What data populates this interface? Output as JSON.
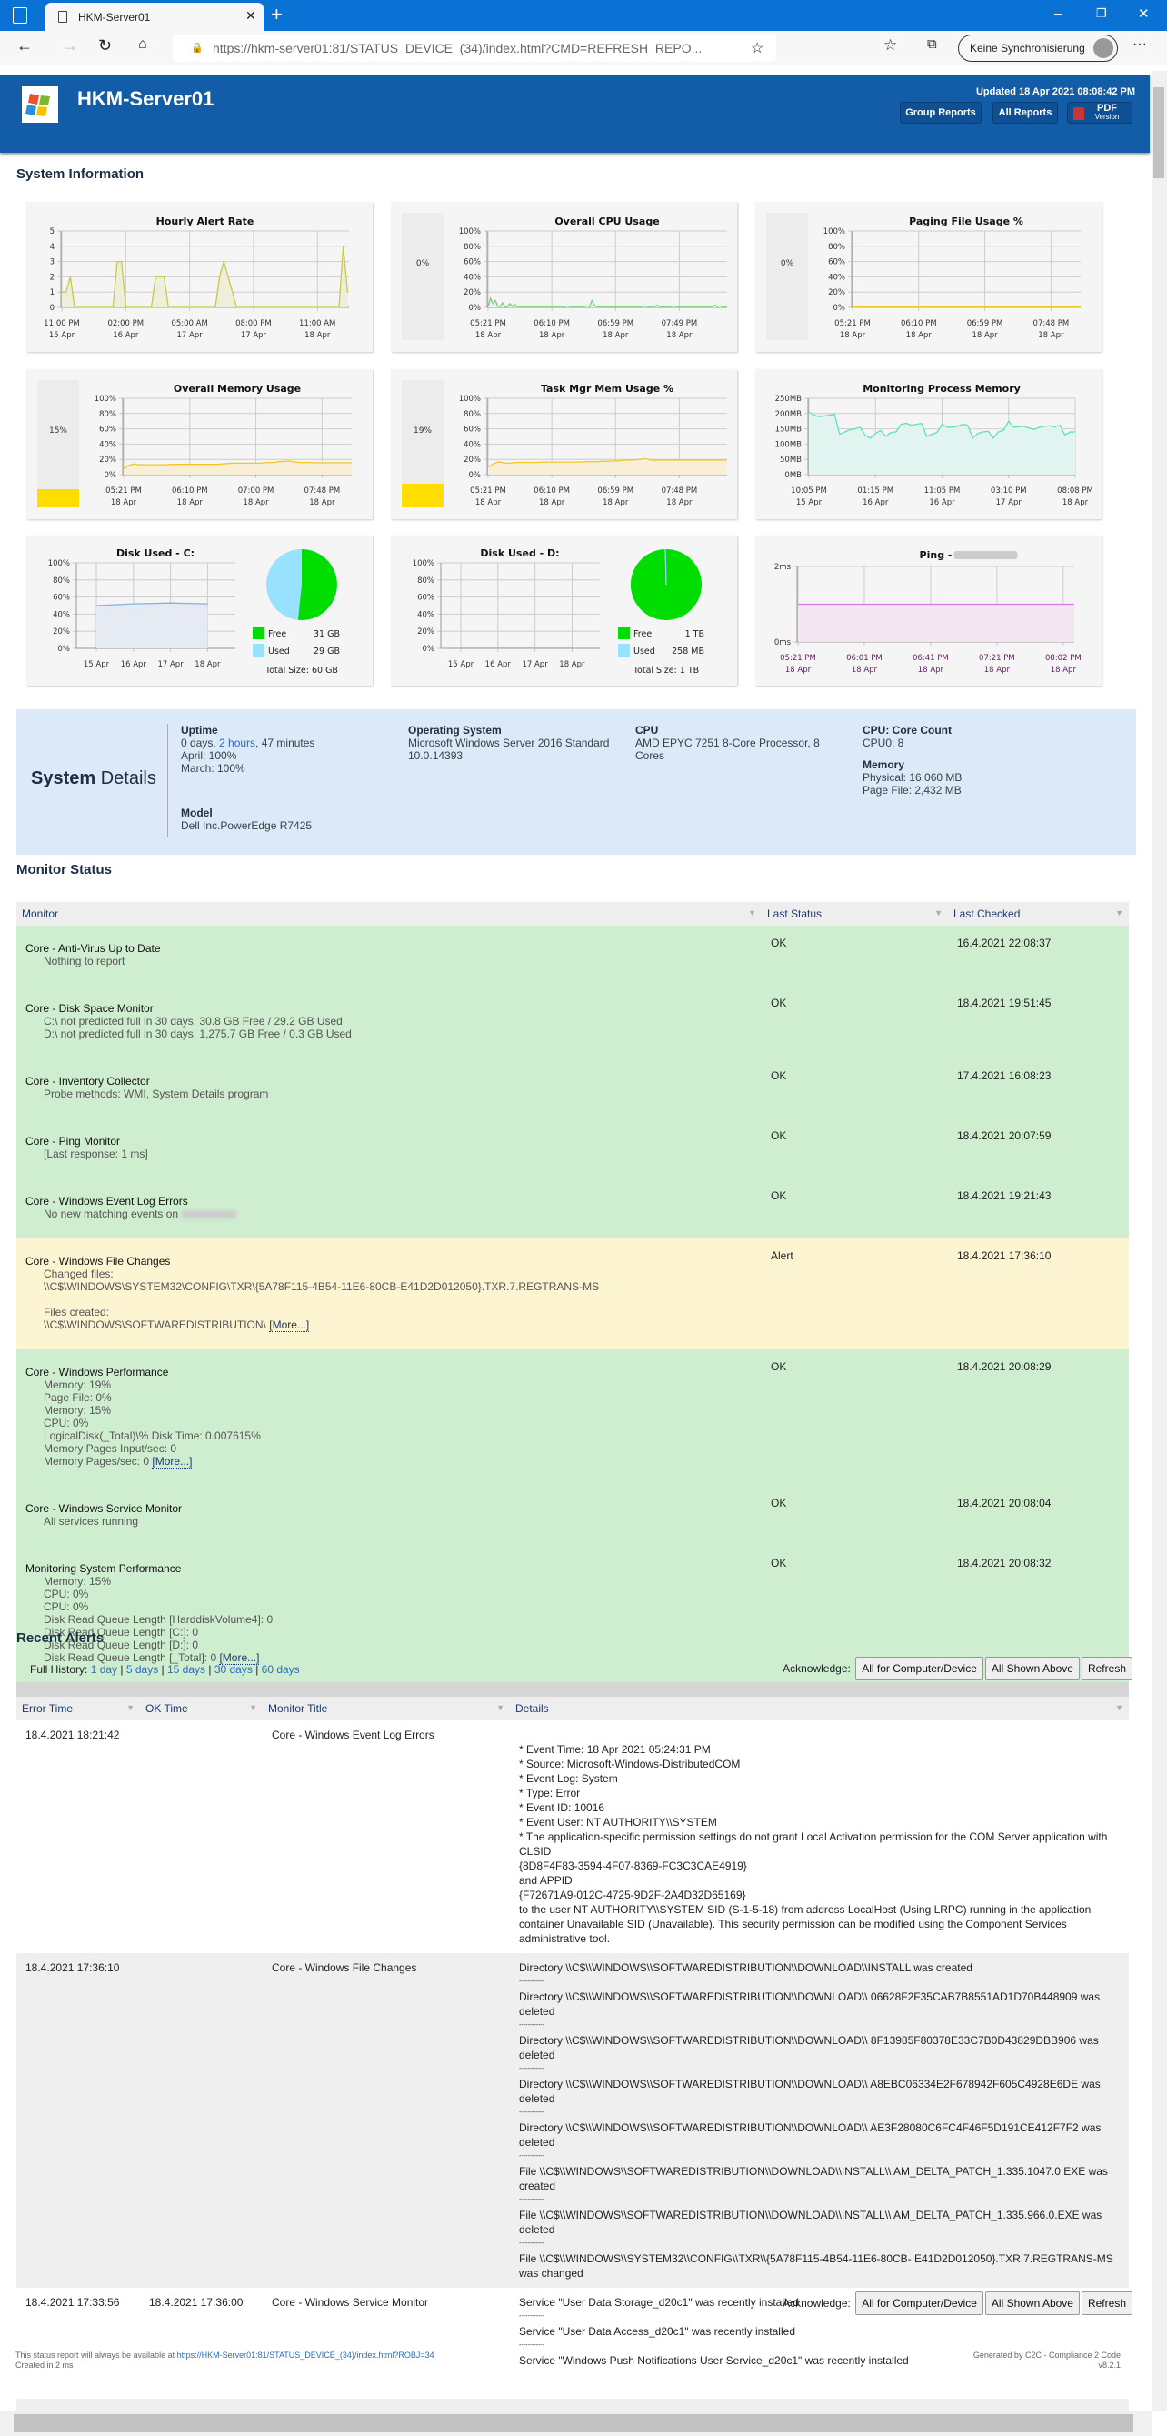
{
  "browser": {
    "tab_title": "HKM-Server01",
    "url": "https://hkm-server01:81/STATUS_DEVICE_(34)/index.html?CMD=REFRESH_REPO...",
    "url_host": "hkm-server01",
    "profile_label": "Keine Synchronisierung"
  },
  "header": {
    "title": "HKM-Server01",
    "updated": "Updated 18 Apr 2021 08:08:42 PM",
    "group_reports": "Group Reports",
    "all_reports": "All Reports",
    "pdf_label": "PDF",
    "pdf_sub": "Version"
  },
  "system_information": {
    "heading": "System Information"
  },
  "chart_data": [
    {
      "id": "hourly",
      "type": "area",
      "title": "Hourly Alert Rate",
      "yticks": [
        "0",
        "1",
        "2",
        "3",
        "4",
        "5"
      ],
      "ylim": [
        0,
        5
      ],
      "xticks": [
        [
          "11:00 PM",
          "15 Apr"
        ],
        [
          "02:00 PM",
          "16 Apr"
        ],
        [
          "05:00 AM",
          "17 Apr"
        ],
        [
          "08:00 PM",
          "17 Apr"
        ],
        [
          "11:00 AM",
          "18 Apr"
        ]
      ],
      "color": "#c5ca4c",
      "fill": "#eeeedb",
      "values": [
        1,
        1,
        2,
        0,
        0,
        0,
        0,
        0,
        0,
        0,
        0,
        0,
        0,
        3,
        3,
        0,
        0,
        0,
        0,
        0,
        0,
        0,
        2,
        2,
        2,
        0,
        0,
        0,
        0,
        0,
        0,
        0,
        0,
        0,
        0,
        0,
        0,
        2,
        3,
        2,
        1,
        0,
        0,
        0,
        0,
        0,
        0,
        0,
        0,
        0,
        0,
        0,
        0,
        0,
        0,
        0,
        0,
        0,
        0,
        0,
        0,
        0,
        0,
        0,
        0,
        0,
        4,
        1
      ]
    },
    {
      "id": "cpu",
      "type": "area",
      "title": "Overall CPU Usage",
      "gauge": 0,
      "gauge_label": "0%",
      "yticks": [
        "0%",
        "20%",
        "40%",
        "60%",
        "80%",
        "100%"
      ],
      "ylim": [
        0,
        100
      ],
      "xticks": [
        [
          "05:21 PM",
          "18 Apr"
        ],
        [
          "06:10 PM",
          "18 Apr"
        ],
        [
          "06:59 PM",
          "18 Apr"
        ],
        [
          "07:49 PM",
          "18 Apr"
        ]
      ],
      "color": "#79d079",
      "fill": "#e8f4e8",
      "values": [
        1,
        12,
        5,
        9,
        2,
        1,
        6,
        1,
        1,
        5,
        1,
        4,
        1,
        1,
        1,
        0,
        1,
        1,
        1,
        1,
        1,
        1,
        1,
        1,
        1,
        1,
        1,
        1,
        1,
        1,
        1,
        1,
        1,
        2,
        1,
        1,
        1,
        1,
        1,
        1,
        1,
        2,
        1,
        9,
        3,
        1,
        1,
        1,
        1,
        1,
        1,
        1,
        1,
        1,
        1,
        1,
        1,
        1,
        1,
        1,
        1,
        1,
        1,
        1,
        1,
        2,
        1,
        1,
        1,
        1,
        3,
        1,
        1,
        1,
        1,
        1,
        1,
        2,
        1,
        1,
        1,
        1,
        1,
        1,
        1,
        1,
        1,
        1,
        1,
        1,
        1,
        1,
        1,
        1,
        3,
        1,
        2,
        1,
        1,
        1
      ]
    },
    {
      "id": "paging",
      "type": "area",
      "title": "Paging File Usage %",
      "gauge": 0,
      "gauge_label": "0%",
      "yticks": [
        "0%",
        "20%",
        "40%",
        "60%",
        "80%",
        "100%"
      ],
      "ylim": [
        0,
        100
      ],
      "xticks": [
        [
          "05:21 PM",
          "18 Apr"
        ],
        [
          "06:10 PM",
          "18 Apr"
        ],
        [
          "06:59 PM",
          "18 Apr"
        ],
        [
          "07:48 PM",
          "18 Apr"
        ]
      ],
      "color": "#f3c624",
      "fill": "#f7efd0",
      "values": [
        0.5,
        0.5,
        0.5,
        0.5,
        0.5,
        0.5,
        0.5,
        0.5,
        0.5,
        0.5
      ]
    },
    {
      "id": "memory",
      "type": "area",
      "title": "Overall Memory Usage",
      "gauge": 15,
      "gauge_label": "15%",
      "yticks": [
        "0%",
        "20%",
        "40%",
        "60%",
        "80%",
        "100%"
      ],
      "ylim": [
        0,
        100
      ],
      "xticks": [
        [
          "05:21 PM",
          "18 Apr"
        ],
        [
          "06:10 PM",
          "18 Apr"
        ],
        [
          "07:00 PM",
          "18 Apr"
        ],
        [
          "07:48 PM",
          "18 Apr"
        ]
      ],
      "color": "#f3c624",
      "fill": "#f8efd6",
      "values": [
        8,
        12,
        14,
        13,
        13,
        13,
        13,
        13,
        13,
        13.5,
        13.5,
        13.5,
        13.5,
        13.5,
        13.5,
        13.5,
        13.5,
        13.5,
        13.5,
        14,
        14.5,
        15,
        15,
        15,
        15,
        15,
        15,
        15.5,
        16,
        16,
        17,
        17.5,
        18,
        16.5,
        16,
        16,
        16,
        15.5,
        15.5,
        15.5,
        15.5,
        15.5,
        15.5,
        15.5,
        15.5
      ]
    },
    {
      "id": "taskmgr",
      "type": "area",
      "title": "Task Mgr Mem Usage %",
      "gauge": 19,
      "gauge_label": "19%",
      "yticks": [
        "0%",
        "20%",
        "40%",
        "60%",
        "80%",
        "100%"
      ],
      "ylim": [
        0,
        100
      ],
      "xticks": [
        [
          "05:21 PM",
          "18 Apr"
        ],
        [
          "06:10 PM",
          "18 Apr"
        ],
        [
          "06:59 PM",
          "18 Apr"
        ],
        [
          "07:48 PM",
          "18 Apr"
        ]
      ],
      "color": "#f3c624",
      "fill": "#f8efd6",
      "values": [
        10,
        14,
        17,
        15,
        15,
        16,
        16,
        16,
        16,
        16,
        16.5,
        16.5,
        16.5,
        16.5,
        16.5,
        16.5,
        16.5,
        16.5,
        17,
        17,
        17,
        17.5,
        17.5,
        18,
        18,
        19,
        19,
        19.5,
        20,
        21,
        19,
        19,
        19,
        19,
        19,
        19,
        19,
        19,
        19,
        19,
        19,
        19,
        19,
        19,
        19
      ]
    },
    {
      "id": "procmem",
      "type": "area",
      "title": "Monitoring Process Memory",
      "yticks": [
        "0MB",
        "50MB",
        "100MB",
        "150MB",
        "200MB",
        "250MB"
      ],
      "ylim": [
        0,
        250
      ],
      "xticks": [
        [
          "10:05 PM",
          "15 Apr"
        ],
        [
          "01:15 PM",
          "16 Apr"
        ],
        [
          "11:05 PM",
          "16 Apr"
        ],
        [
          "03:10 PM",
          "17 Apr"
        ],
        [
          "08:08 PM",
          "18 Apr"
        ]
      ],
      "color": "#5fe0c2",
      "fill": "#e1f4ef",
      "values": [
        205,
        195,
        190,
        192,
        195,
        197,
        132,
        140,
        147,
        150,
        155,
        128,
        120,
        135,
        145,
        125,
        138,
        140,
        165,
        168,
        162,
        165,
        168,
        125,
        132,
        138,
        165,
        155,
        155,
        158,
        165,
        162,
        120,
        135,
        140,
        142,
        120,
        140,
        145,
        175,
        155,
        157,
        158,
        152,
        148,
        155,
        158,
        160,
        156,
        162,
        130,
        140,
        140
      ]
    },
    {
      "id": "diskc",
      "type": "disk",
      "title": "Disk Used - C:",
      "yticks": [
        "0%",
        "20%",
        "40%",
        "60%",
        "80%",
        "100%"
      ],
      "ylim": [
        0,
        100
      ],
      "xticks": [
        [
          "15 Apr",
          ""
        ],
        [
          "16 Apr",
          ""
        ],
        [
          "17 Apr",
          ""
        ],
        [
          "18 Apr",
          ""
        ]
      ],
      "color": "#86b2e6",
      "fill": "#e6eaf3",
      "values": [
        50,
        52,
        53,
        52
      ],
      "pie": {
        "free": 31,
        "used": 29,
        "free_label": "Free",
        "used_label": "Used",
        "free_value": "31 GB",
        "used_value": "29 GB",
        "total": "Total Size: 60 GB"
      }
    },
    {
      "id": "diskd",
      "type": "disk",
      "title": "Disk Used - D:",
      "yticks": [
        "0%",
        "20%",
        "40%",
        "60%",
        "80%",
        "100%"
      ],
      "ylim": [
        0,
        100
      ],
      "xticks": [
        [
          "15 Apr",
          ""
        ],
        [
          "16 Apr",
          ""
        ],
        [
          "17 Apr",
          ""
        ],
        [
          "18 Apr",
          ""
        ]
      ],
      "color": "#86b2e6",
      "fill": "#e6eaf3",
      "values": [
        1,
        1,
        1,
        1
      ],
      "pie": {
        "free": 1024,
        "used": 0.258,
        "free_label": "Free",
        "used_label": "Used",
        "free_value": "1 TB",
        "used_value": "258 MB",
        "total": "Total Size: 1 TB"
      }
    },
    {
      "id": "ping",
      "type": "area",
      "title": "Ping -",
      "yticks": [
        "0ms",
        "2ms"
      ],
      "ylim": [
        0,
        2
      ],
      "xticks": [
        [
          "05:21 PM",
          "18 Apr"
        ],
        [
          "06:01 PM",
          "18 Apr"
        ],
        [
          "06:41 PM",
          "18 Apr"
        ],
        [
          "07:21 PM",
          "18 Apr"
        ],
        [
          "08:02 PM",
          "18 Apr"
        ]
      ],
      "color": "#d47ae4",
      "fill": "#f2e6f3",
      "values": [
        1,
        1,
        1,
        1,
        1
      ]
    }
  ],
  "colors": {
    "pie_free": "#00dd00",
    "pie_used": "#99e2ff",
    "gauge_fill": "#ffdd00",
    "ok_row": "#cfedcf",
    "alert_row": "#fdf4d2",
    "header": "#125ca8"
  },
  "system_details": {
    "title_bold": "System",
    "title_rest": " Details",
    "uptime": {
      "label": "Uptime",
      "line1_a": "0 days, ",
      "line1_b": "2 hours",
      "line1_c": ", 47 minutes",
      "april": "April: 100%",
      "march": "March: 100%"
    },
    "os": {
      "label": "Operating System",
      "line1": "Microsoft Windows Server 2016 Standard",
      "line2": "10.0.14393"
    },
    "cpu": {
      "label": "CPU",
      "line1": "AMD EPYC 7251 8-Core Processor, 8",
      "line2": "Cores"
    },
    "cores": {
      "label": "CPU: Core Count",
      "value": "CPU0: 8"
    },
    "memory": {
      "label": "Memory",
      "physical": "Physical: 16,060 MB",
      "pagefile": "Page File: 2,432 MB"
    },
    "model": {
      "label": "Model",
      "value": "Dell Inc.PowerEdge R7425"
    }
  },
  "monitor_status": {
    "heading": "Monitor Status",
    "columns": [
      "Monitor",
      "Last Status",
      "Last Checked"
    ],
    "rows": [
      {
        "title": "Core - Anti-Virus Up to Date",
        "lines": [
          "Nothing to report"
        ],
        "status": "OK",
        "checked": "16.4.2021 22:08:37",
        "state": "ok"
      },
      {
        "title": "Core - Disk Space Monitor",
        "lines": [
          "C:\\ not predicted full in 30 days, 30.8 GB Free / 29.2 GB Used",
          "D:\\ not predicted full in 30 days, 1,275.7 GB Free / 0.3 GB Used"
        ],
        "status": "OK",
        "checked": "18.4.2021 19:51:45",
        "state": "ok"
      },
      {
        "title": "Core - Inventory Collector",
        "lines": [
          "Probe methods: WMI, System Details program"
        ],
        "status": "OK",
        "checked": "17.4.2021 16:08:23",
        "state": "ok"
      },
      {
        "title": "Core - Ping Monitor",
        "lines": [
          "[Last response: 1 ms]"
        ],
        "status": "OK",
        "checked": "18.4.2021 20:07:59",
        "state": "ok"
      },
      {
        "title": "Core - Windows Event Log Errors",
        "lines": [
          "No new matching events on"
        ],
        "blur_last": true,
        "status": "OK",
        "checked": "18.4.2021 19:21:43",
        "state": "ok"
      },
      {
        "title": "Core - Windows File Changes",
        "lines": [
          "Changed files:",
          "\\\\C$\\WINDOWS\\SYSTEM32\\CONFIG\\TXR\\{5A78F115-4B54-11E6-80CB-E41D2D012050}.TXR.7.REGTRANS-MS",
          "",
          "Files created:",
          "\\\\C$\\WINDOWS\\SOFTWAREDISTRIBUTION\\"
        ],
        "more": "[More...]",
        "status": "Alert",
        "checked": "18.4.2021 17:36:10",
        "state": "alert"
      },
      {
        "title": "Core - Windows Performance",
        "lines": [
          "Memory: 19%",
          "Page File: 0%",
          "Memory: 15%",
          "CPU: 0%",
          "LogicalDisk(_Total)\\% Disk Time: 0.007615%",
          "Memory Pages Input/sec: 0",
          "Memory Pages/sec: 0"
        ],
        "more": "[More...]",
        "status": "OK",
        "checked": "18.4.2021 20:08:29",
        "state": "ok"
      },
      {
        "title": "Core - Windows Service Monitor",
        "lines": [
          "All services running"
        ],
        "status": "OK",
        "checked": "18.4.2021 20:08:04",
        "state": "ok"
      },
      {
        "title": "Monitoring System Performance",
        "lines": [
          "Memory: 15%",
          "CPU: 0%",
          "CPU: 0%",
          "Disk Read Queue Length [HarddiskVolume4]: 0",
          "Disk Read Queue Length [C:]: 0",
          "Disk Read Queue Length [D:]: 0",
          "Disk Read Queue Length [_Total]: 0"
        ],
        "more": "[More...]",
        "status": "OK",
        "checked": "18.4.2021 20:08:32",
        "state": "ok"
      }
    ]
  },
  "recent_alerts": {
    "heading": "Recent Alerts",
    "history_label": "Full History:",
    "history_links": [
      "1 day",
      "5 days",
      "15 days",
      "30 days",
      "60 days"
    ],
    "acknowledge_label": "Acknowledge:",
    "btn_all_device": "All for Computer/Device",
    "btn_all_shown": "All Shown Above",
    "btn_refresh": "Refresh",
    "columns": [
      "Error Time",
      "OK Time",
      "Monitor Title",
      "Details"
    ],
    "rows": [
      {
        "error_time": "18.4.2021 18:21:42",
        "ok_time": "",
        "title": "Core - Windows Event Log Errors",
        "details": [
          "",
          "* Event Time: 18 Apr 2021 05:24:31 PM",
          "* Source: Microsoft-Windows-DistributedCOM",
          "* Event Log: System",
          "* Type: Error",
          "* Event ID: 10016",
          "* Event User: NT AUTHORITY\\\\SYSTEM",
          "* The application-specific permission settings do not grant Local Activation permission for the COM Server application with CLSID",
          "{8D8F4F83-3594-4F07-8369-FC3C3CAE4919}",
          "and APPID",
          "{F72671A9-012C-4725-9D2F-2A4D32D65169}",
          "to the user NT AUTHORITY\\\\SYSTEM SID (S-1-5-18) from address LocalHost (Using LRPC) running in the application container Unavailable SID (Unavailable). This security permission can be modified using the Component Services administrative tool."
        ]
      },
      {
        "error_time": "18.4.2021 17:36:10",
        "ok_time": "",
        "title": "Core - Windows File Changes",
        "details": [
          "Directory \\\\C$\\\\WINDOWS\\\\SOFTWAREDISTRIBUTION\\\\DOWNLOAD\\\\INSTALL was created",
          "------------",
          "Directory \\\\C$\\\\WINDOWS\\\\SOFTWAREDISTRIBUTION\\\\DOWNLOAD\\\\ 06628F2F35CAB7B8551AD1D70B448909 was deleted",
          "------------",
          "Directory \\\\C$\\\\WINDOWS\\\\SOFTWAREDISTRIBUTION\\\\DOWNLOAD\\\\ 8F13985F80378E33C7B0D43829DBB906 was deleted",
          "------------",
          "Directory \\\\C$\\\\WINDOWS\\\\SOFTWAREDISTRIBUTION\\\\DOWNLOAD\\\\ A8EBC06334E2F678942F605C4928E6DE was deleted",
          "------------",
          "Directory \\\\C$\\\\WINDOWS\\\\SOFTWAREDISTRIBUTION\\\\DOWNLOAD\\\\ AE3F28080C6FC4F46F5D191CE412F7F2 was deleted",
          "------------",
          "File \\\\C$\\\\WINDOWS\\\\SOFTWAREDISTRIBUTION\\\\DOWNLOAD\\\\INSTALL\\\\ AM_DELTA_PATCH_1.335.1047.0.EXE was created",
          "------------",
          "File \\\\C$\\\\WINDOWS\\\\SOFTWAREDISTRIBUTION\\\\DOWNLOAD\\\\INSTALL\\\\ AM_DELTA_PATCH_1.335.966.0.EXE was deleted",
          "------------",
          "File \\\\C$\\\\WINDOWS\\\\SYSTEM32\\\\CONFIG\\\\TXR\\\\{5A78F115-4B54-11E6-80CB- E41D2D012050}.TXR.7.REGTRANS-MS was changed"
        ]
      },
      {
        "error_time": "18.4.2021 17:33:56",
        "ok_time": "18.4.2021 17:36:00",
        "title": "Core - Windows Service Monitor",
        "details": [
          "Service \"User Data Storage_d20c1\" was recently installed",
          "------------",
          "Service \"User Data Access_d20c1\" was recently installed",
          "------------",
          "Service \"Windows Push Notifications User Service_d20c1\" was recently installed"
        ]
      }
    ]
  },
  "footer": {
    "available_text": "This status report will always be available at ",
    "available_link": "https://HKM-Server01:81/STATUS_DEVICE_(34)/index.html?ROBJ=34",
    "created": "Created in 2 ms",
    "generated": "Generated by C2C - Compliance 2 Code",
    "version": "v8.2.1"
  }
}
